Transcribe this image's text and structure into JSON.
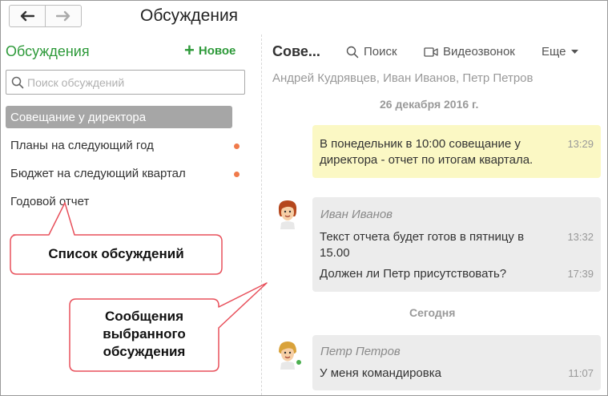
{
  "window": {
    "title": "Обсуждения"
  },
  "left": {
    "title": "Обсуждения",
    "new_label": "Новое",
    "search_placeholder": "Поиск обсуждений",
    "items": [
      {
        "label": "Совещание у директора",
        "selected": true,
        "unread": false
      },
      {
        "label": "Планы на следующий год",
        "selected": false,
        "unread": true
      },
      {
        "label": "Бюджет на следующий квартал",
        "selected": false,
        "unread": true
      },
      {
        "label": "Годовой отчет",
        "selected": false,
        "unread": false
      }
    ]
  },
  "callouts": {
    "list": "Список обсуждений",
    "messages": [
      "Сообщения",
      "выбранного",
      "обсуждения"
    ]
  },
  "conversation": {
    "title": "Сове...",
    "toolbar": {
      "search": "Поиск",
      "video": "Видеозвонок",
      "more": "Еще"
    },
    "participants": "Андрей Кудрявцев, Иван Иванов, Петр Петров",
    "date1": "26 декабря 2016 г.",
    "date2": "Сегодня",
    "own_message": {
      "text": "В понедельник в 10:00 совещание у директора - отчет по итогам квартала.",
      "time": "13:29"
    },
    "group1": {
      "author": "Иван Иванов",
      "messages": [
        {
          "text": "Текст отчета будет готов в пятницу в 15.00",
          "time": "13:32"
        },
        {
          "text": "Должен ли Петр присутствовать?",
          "time": "17:39"
        }
      ]
    },
    "group2": {
      "author": "Петр Петров",
      "messages": [
        {
          "text": "У меня командировка",
          "time": "11:07"
        }
      ]
    }
  },
  "colors": {
    "accent": "#2e9a3a",
    "unread_dot": "#f07a4a",
    "own_bubble": "#fbf8c4",
    "callout_border": "#e8505b"
  },
  "icons": [
    "arrow-left-icon",
    "arrow-right-icon",
    "plus-icon",
    "search-icon",
    "video-icon",
    "caret-down-icon"
  ]
}
